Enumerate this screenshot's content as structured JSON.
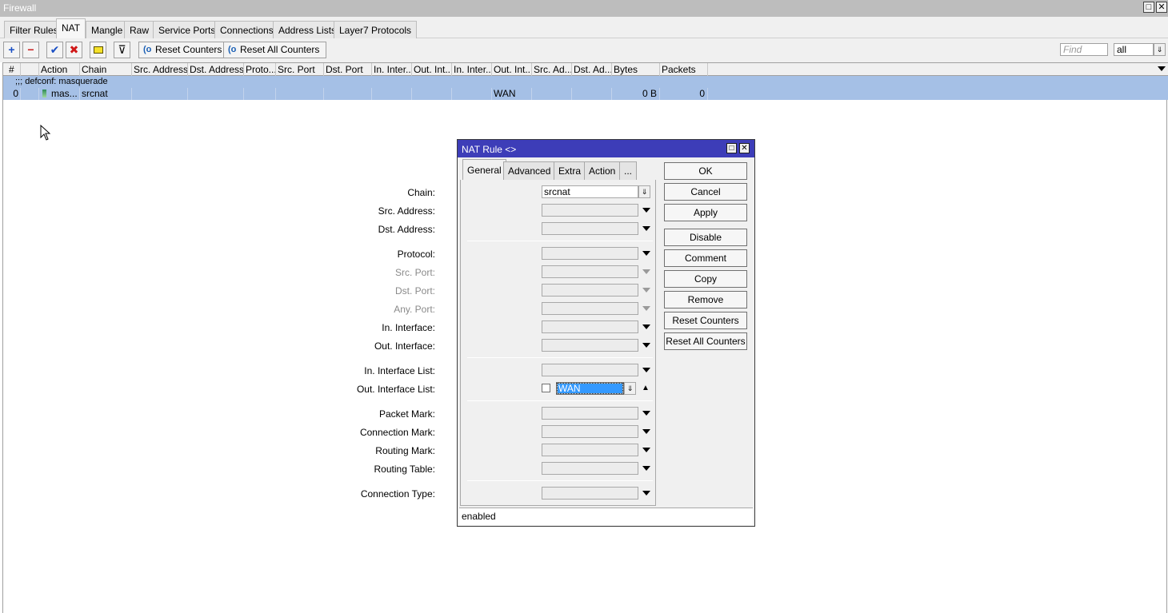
{
  "window": {
    "title": "Firewall",
    "restore_icon": "restore-icon",
    "close_icon": "close-icon",
    "restore_glyph": "□",
    "close_glyph": "✕"
  },
  "tabs": [
    "Filter Rules",
    "NAT",
    "Mangle",
    "Raw",
    "Service Ports",
    "Connections",
    "Address Lists",
    "Layer7 Protocols"
  ],
  "active_tab": "NAT",
  "toolbar": {
    "icons": [
      "add-icon",
      "remove-icon",
      "enable-check-icon",
      "disable-x-icon",
      "comment-note-icon",
      "filter-icon"
    ],
    "icon_glyphs": {
      "add": "+",
      "remove": "−",
      "enable": "✔",
      "disable": "✖",
      "filter": "⊽"
    },
    "reset_counters": "Reset Counters",
    "reset_all_counters": "Reset All Counters",
    "reset_glyph": "(o",
    "find_placeholder": "Find",
    "filter_select": "all"
  },
  "table": {
    "columns": [
      "#",
      "",
      "Action",
      "Chain",
      "Src. Address",
      "Dst. Address",
      "Proto...",
      "Src. Port",
      "Dst. Port",
      "In. Inter...",
      "Out. Int...",
      "In. Inter...",
      "Out. Int...",
      "Src. Ad...",
      "Dst. Ad...",
      "Bytes",
      "Packets"
    ],
    "comment_row": ";;; defconf: masquerade",
    "rows": [
      {
        "num": "0",
        "action": "mas...",
        "chain": "srcnat",
        "out_interface_list": "WAN",
        "bytes": "0 B",
        "packets": "0"
      }
    ]
  },
  "dialog": {
    "title": "NAT Rule <>",
    "tabs": [
      "General",
      "Advanced",
      "Extra",
      "Action",
      "..."
    ],
    "active_tab": "General",
    "fields": {
      "chain": {
        "label": "Chain:",
        "value": "srcnat"
      },
      "src_address": {
        "label": "Src. Address:",
        "value": ""
      },
      "dst_address": {
        "label": "Dst. Address:",
        "value": ""
      },
      "protocol": {
        "label": "Protocol:",
        "value": ""
      },
      "src_port": {
        "label": "Src. Port:",
        "value": ""
      },
      "dst_port": {
        "label": "Dst. Port:",
        "value": ""
      },
      "any_port": {
        "label": "Any. Port:",
        "value": ""
      },
      "in_interface": {
        "label": "In. Interface:",
        "value": ""
      },
      "out_interface": {
        "label": "Out. Interface:",
        "value": ""
      },
      "in_interface_list": {
        "label": "In. Interface List:",
        "value": ""
      },
      "out_interface_list": {
        "label": "Out. Interface List:",
        "value": "WAN",
        "negate": false
      },
      "packet_mark": {
        "label": "Packet Mark:",
        "value": ""
      },
      "connection_mark": {
        "label": "Connection Mark:",
        "value": ""
      },
      "routing_mark": {
        "label": "Routing Mark:",
        "value": ""
      },
      "routing_table": {
        "label": "Routing Table:",
        "value": ""
      },
      "connection_type": {
        "label": "Connection Type:",
        "value": ""
      }
    },
    "buttons": [
      "OK",
      "Cancel",
      "Apply",
      "Disable",
      "Comment",
      "Copy",
      "Remove",
      "Reset Counters",
      "Reset All Counters"
    ],
    "status": "enabled",
    "dropdown_glyph": "⇓",
    "collapse_glyph": "▲"
  }
}
